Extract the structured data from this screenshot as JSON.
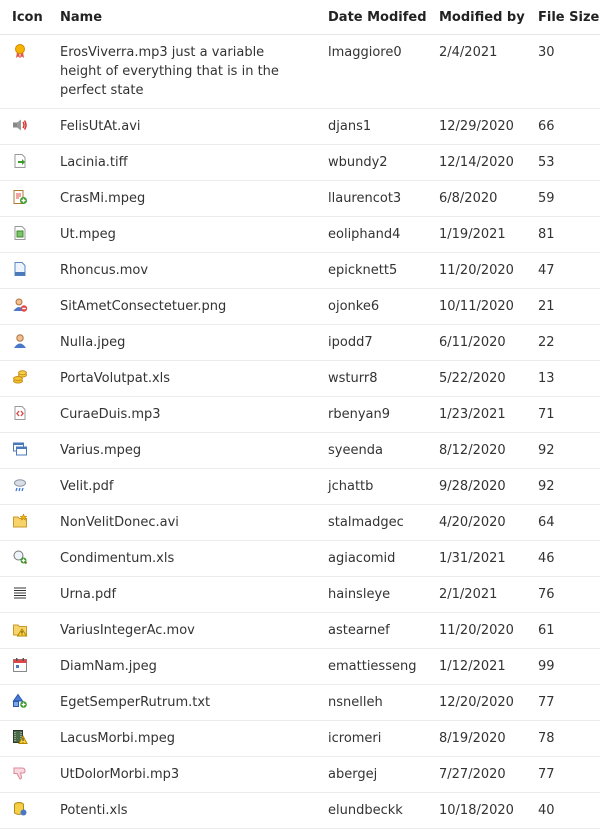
{
  "columns": {
    "icon": "Icon",
    "name": "Name",
    "date": "Date Modifed",
    "modified_by": "Modified by",
    "size": "File Size"
  },
  "rows": [
    {
      "icon": "award-icon",
      "name": "ErosViverra.mp3 just a variable height of everything that is in the perfect state",
      "date": "lmaggiore0",
      "modified_by": "2/4/2021",
      "size": "30"
    },
    {
      "icon": "speaker-icon",
      "name": "FelisUtAt.avi",
      "date": "djans1",
      "modified_by": "12/29/2020",
      "size": "66"
    },
    {
      "icon": "page-forward-icon",
      "name": "Lacinia.tiff",
      "date": "wbundy2",
      "modified_by": "12/14/2020",
      "size": "53"
    },
    {
      "icon": "report-add-icon",
      "name": "CrasMi.mpeg",
      "date": "llaurencot3",
      "modified_by": "6/8/2020",
      "size": "59"
    },
    {
      "icon": "page-image-icon",
      "name": "Ut.mpeg",
      "date": "eoliphand4",
      "modified_by": "1/19/2021",
      "size": "81"
    },
    {
      "icon": "page-blank-icon",
      "name": "Rhoncus.mov",
      "date": "epicknett5",
      "modified_by": "11/20/2020",
      "size": "47"
    },
    {
      "icon": "user-delete-icon",
      "name": "SitAmetConsectetuer.png",
      "date": "ojonke6",
      "modified_by": "10/11/2020",
      "size": "21"
    },
    {
      "icon": "user-icon",
      "name": "Nulla.jpeg",
      "date": "ipodd7",
      "modified_by": "6/11/2020",
      "size": "22"
    },
    {
      "icon": "coins-icon",
      "name": "PortaVolutpat.xls",
      "date": "wsturr8",
      "modified_by": "5/22/2020",
      "size": "13"
    },
    {
      "icon": "page-code-icon",
      "name": "CuraeDuis.mp3",
      "date": "rbenyan9",
      "modified_by": "1/23/2021",
      "size": "71"
    },
    {
      "icon": "windows-icon",
      "name": "Varius.mpeg",
      "date": "syeenda",
      "modified_by": "8/12/2020",
      "size": "92"
    },
    {
      "icon": "weather-rain-icon",
      "name": "Velit.pdf",
      "date": "jchattb",
      "modified_by": "9/28/2020",
      "size": "92"
    },
    {
      "icon": "folder-star-icon",
      "name": "NonVelitDonec.avi",
      "date": "stalmadgec",
      "modified_by": "4/20/2020",
      "size": "64"
    },
    {
      "icon": "zoom-add-icon",
      "name": "Condimentum.xls",
      "date": "agiacomid",
      "modified_by": "1/31/2021",
      "size": "46"
    },
    {
      "icon": "text-align-icon",
      "name": "Urna.pdf",
      "date": "hainsleye",
      "modified_by": "2/1/2021",
      "size": "76"
    },
    {
      "icon": "folder-warning-icon",
      "name": "VariusIntegerAc.mov",
      "date": "astearnef",
      "modified_by": "11/20/2020",
      "size": "61"
    },
    {
      "icon": "calendar-icon",
      "name": "DiamNam.jpeg",
      "date": "emattiesseng",
      "modified_by": "1/12/2021",
      "size": "99"
    },
    {
      "icon": "shapes-add-icon",
      "name": "EgetSemperRutrum.txt",
      "date": "nsnelleh",
      "modified_by": "12/20/2020",
      "size": "77"
    },
    {
      "icon": "film-warning-icon",
      "name": "LacusMorbi.mpeg",
      "date": "icromeri",
      "modified_by": "8/19/2020",
      "size": "78"
    },
    {
      "icon": "thumb-down-icon",
      "name": "UtDolorMorbi.mp3",
      "date": "abergej",
      "modified_by": "7/27/2020",
      "size": "77"
    },
    {
      "icon": "database-icon",
      "name": "Potenti.xls",
      "date": "elundbeckk",
      "modified_by": "10/18/2020",
      "size": "40"
    }
  ]
}
